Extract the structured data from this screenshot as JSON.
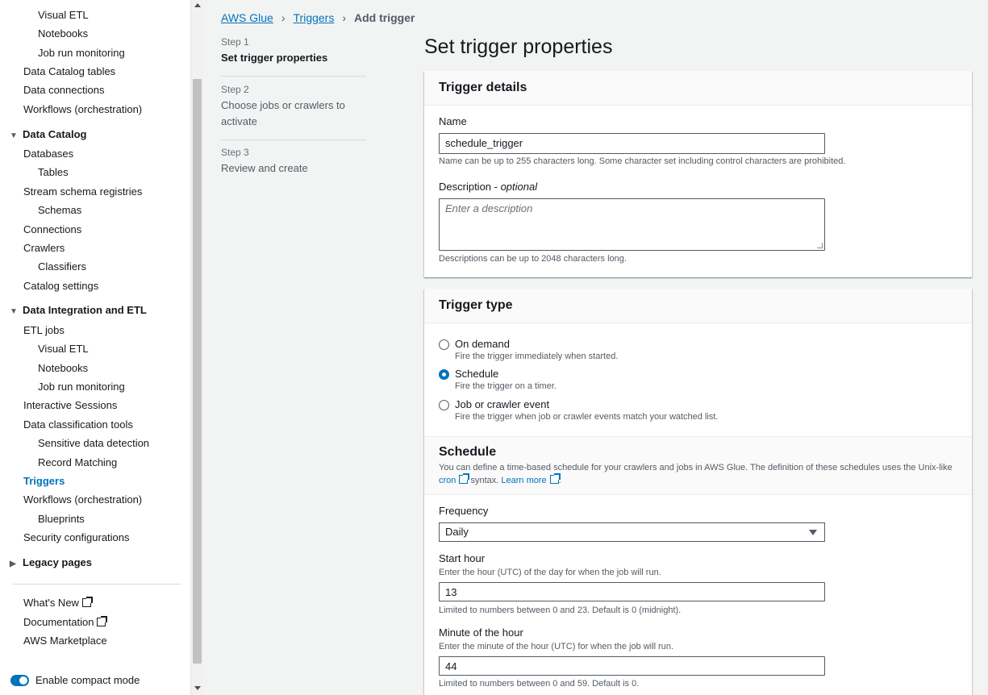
{
  "sidebar": {
    "items": [
      {
        "label": "Visual ETL",
        "level": 2
      },
      {
        "label": "Notebooks",
        "level": 2
      },
      {
        "label": "Job run monitoring",
        "level": 2
      },
      {
        "label": "Data Catalog tables",
        "level": 1
      },
      {
        "label": "Data connections",
        "level": 1
      },
      {
        "label": "Workflows (orchestration)",
        "level": 1
      }
    ],
    "section_data_catalog": "Data Catalog",
    "data_catalog_items": [
      "Databases",
      "Tables",
      "Stream schema registries",
      "Schemas",
      "Connections",
      "Crawlers",
      "Classifiers",
      "Catalog settings"
    ],
    "section_data_integration": "Data Integration and ETL",
    "data_integration_items": [
      "ETL jobs",
      "Visual ETL",
      "Notebooks",
      "Job run monitoring",
      "Interactive Sessions",
      "Data classification tools",
      "Sensitive data detection",
      "Record Matching",
      "Triggers",
      "Workflows (orchestration)",
      "Blueprints",
      "Security configurations"
    ],
    "section_legacy": "Legacy pages",
    "footer_links": [
      "What's New",
      "Documentation",
      "AWS Marketplace"
    ],
    "compact_mode_label": "Enable compact mode",
    "compact_mode_on": true
  },
  "breadcrumb": {
    "items": [
      "AWS Glue",
      "Triggers"
    ],
    "current": "Add trigger"
  },
  "steps": [
    {
      "num": "Step 1",
      "title": "Set trigger properties",
      "active": true
    },
    {
      "num": "Step 2",
      "title": "Choose jobs or crawlers to activate",
      "active": false
    },
    {
      "num": "Step 3",
      "title": "Review and create",
      "active": false
    }
  ],
  "page_title": "Set trigger properties",
  "trigger_details": {
    "header": "Trigger details",
    "name_label": "Name",
    "name_value": "schedule_trigger",
    "name_hint": "Name can be up to 255 characters long. Some character set including control characters are prohibited.",
    "description_label": "Description - ",
    "description_optional": "optional",
    "description_placeholder": "Enter a description",
    "description_hint": "Descriptions can be up to 2048 characters long."
  },
  "trigger_type": {
    "header": "Trigger type",
    "options": [
      {
        "label": "On demand",
        "desc": "Fire the trigger immediately when started.",
        "checked": false
      },
      {
        "label": "Schedule",
        "desc": "Fire the trigger on a timer.",
        "checked": true
      },
      {
        "label": "Job or crawler event",
        "desc": "Fire the trigger when job or crawler events match your watched list.",
        "checked": false
      }
    ],
    "schedule": {
      "title": "Schedule",
      "desc_text": "You can define a time-based schedule for your crawlers and jobs in AWS Glue. The definition of these schedules uses the Unix-like",
      "cron_link": "cron",
      "syntax_text": "syntax.",
      "learn_more": "Learn more",
      "period": "."
    },
    "frequency_label": "Frequency",
    "frequency_value": "Daily",
    "start_hour_label": "Start hour",
    "start_hour_hint": "Enter the hour (UTC) of the day for when the job will run.",
    "start_hour_value": "13",
    "start_hour_limit": "Limited to numbers between 0 and 23. Default is 0 (midnight).",
    "minute_label": "Minute of the hour",
    "minute_hint": "Enter the minute of the hour (UTC) for when the job will run.",
    "minute_value": "44",
    "minute_limit": "Limited to numbers between 0 and 59. Default is 0."
  },
  "colors": {
    "accent": "#0073bb",
    "background": "#f2f3f3",
    "text": "#16191f"
  }
}
